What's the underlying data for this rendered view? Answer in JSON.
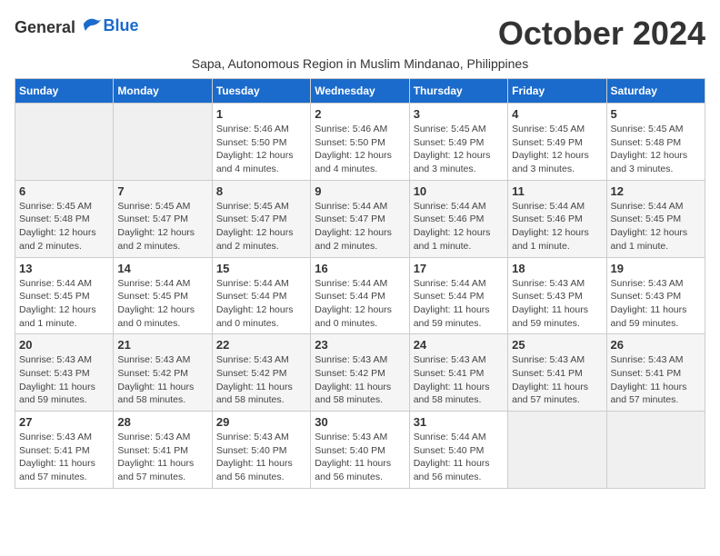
{
  "header": {
    "logo_general": "General",
    "logo_blue": "Blue",
    "month_title": "October 2024",
    "subtitle": "Sapa, Autonomous Region in Muslim Mindanao, Philippines"
  },
  "days_of_week": [
    "Sunday",
    "Monday",
    "Tuesday",
    "Wednesday",
    "Thursday",
    "Friday",
    "Saturday"
  ],
  "weeks": [
    [
      {
        "num": "",
        "info": ""
      },
      {
        "num": "",
        "info": ""
      },
      {
        "num": "1",
        "info": "Sunrise: 5:46 AM\nSunset: 5:50 PM\nDaylight: 12 hours and 4 minutes."
      },
      {
        "num": "2",
        "info": "Sunrise: 5:46 AM\nSunset: 5:50 PM\nDaylight: 12 hours and 4 minutes."
      },
      {
        "num": "3",
        "info": "Sunrise: 5:45 AM\nSunset: 5:49 PM\nDaylight: 12 hours and 3 minutes."
      },
      {
        "num": "4",
        "info": "Sunrise: 5:45 AM\nSunset: 5:49 PM\nDaylight: 12 hours and 3 minutes."
      },
      {
        "num": "5",
        "info": "Sunrise: 5:45 AM\nSunset: 5:48 PM\nDaylight: 12 hours and 3 minutes."
      }
    ],
    [
      {
        "num": "6",
        "info": "Sunrise: 5:45 AM\nSunset: 5:48 PM\nDaylight: 12 hours and 2 minutes."
      },
      {
        "num": "7",
        "info": "Sunrise: 5:45 AM\nSunset: 5:47 PM\nDaylight: 12 hours and 2 minutes."
      },
      {
        "num": "8",
        "info": "Sunrise: 5:45 AM\nSunset: 5:47 PM\nDaylight: 12 hours and 2 minutes."
      },
      {
        "num": "9",
        "info": "Sunrise: 5:44 AM\nSunset: 5:47 PM\nDaylight: 12 hours and 2 minutes."
      },
      {
        "num": "10",
        "info": "Sunrise: 5:44 AM\nSunset: 5:46 PM\nDaylight: 12 hours and 1 minute."
      },
      {
        "num": "11",
        "info": "Sunrise: 5:44 AM\nSunset: 5:46 PM\nDaylight: 12 hours and 1 minute."
      },
      {
        "num": "12",
        "info": "Sunrise: 5:44 AM\nSunset: 5:45 PM\nDaylight: 12 hours and 1 minute."
      }
    ],
    [
      {
        "num": "13",
        "info": "Sunrise: 5:44 AM\nSunset: 5:45 PM\nDaylight: 12 hours and 1 minute."
      },
      {
        "num": "14",
        "info": "Sunrise: 5:44 AM\nSunset: 5:45 PM\nDaylight: 12 hours and 0 minutes."
      },
      {
        "num": "15",
        "info": "Sunrise: 5:44 AM\nSunset: 5:44 PM\nDaylight: 12 hours and 0 minutes."
      },
      {
        "num": "16",
        "info": "Sunrise: 5:44 AM\nSunset: 5:44 PM\nDaylight: 12 hours and 0 minutes."
      },
      {
        "num": "17",
        "info": "Sunrise: 5:44 AM\nSunset: 5:44 PM\nDaylight: 11 hours and 59 minutes."
      },
      {
        "num": "18",
        "info": "Sunrise: 5:43 AM\nSunset: 5:43 PM\nDaylight: 11 hours and 59 minutes."
      },
      {
        "num": "19",
        "info": "Sunrise: 5:43 AM\nSunset: 5:43 PM\nDaylight: 11 hours and 59 minutes."
      }
    ],
    [
      {
        "num": "20",
        "info": "Sunrise: 5:43 AM\nSunset: 5:43 PM\nDaylight: 11 hours and 59 minutes."
      },
      {
        "num": "21",
        "info": "Sunrise: 5:43 AM\nSunset: 5:42 PM\nDaylight: 11 hours and 58 minutes."
      },
      {
        "num": "22",
        "info": "Sunrise: 5:43 AM\nSunset: 5:42 PM\nDaylight: 11 hours and 58 minutes."
      },
      {
        "num": "23",
        "info": "Sunrise: 5:43 AM\nSunset: 5:42 PM\nDaylight: 11 hours and 58 minutes."
      },
      {
        "num": "24",
        "info": "Sunrise: 5:43 AM\nSunset: 5:41 PM\nDaylight: 11 hours and 58 minutes."
      },
      {
        "num": "25",
        "info": "Sunrise: 5:43 AM\nSunset: 5:41 PM\nDaylight: 11 hours and 57 minutes."
      },
      {
        "num": "26",
        "info": "Sunrise: 5:43 AM\nSunset: 5:41 PM\nDaylight: 11 hours and 57 minutes."
      }
    ],
    [
      {
        "num": "27",
        "info": "Sunrise: 5:43 AM\nSunset: 5:41 PM\nDaylight: 11 hours and 57 minutes."
      },
      {
        "num": "28",
        "info": "Sunrise: 5:43 AM\nSunset: 5:41 PM\nDaylight: 11 hours and 57 minutes."
      },
      {
        "num": "29",
        "info": "Sunrise: 5:43 AM\nSunset: 5:40 PM\nDaylight: 11 hours and 56 minutes."
      },
      {
        "num": "30",
        "info": "Sunrise: 5:43 AM\nSunset: 5:40 PM\nDaylight: 11 hours and 56 minutes."
      },
      {
        "num": "31",
        "info": "Sunrise: 5:44 AM\nSunset: 5:40 PM\nDaylight: 11 hours and 56 minutes."
      },
      {
        "num": "",
        "info": ""
      },
      {
        "num": "",
        "info": ""
      }
    ]
  ]
}
